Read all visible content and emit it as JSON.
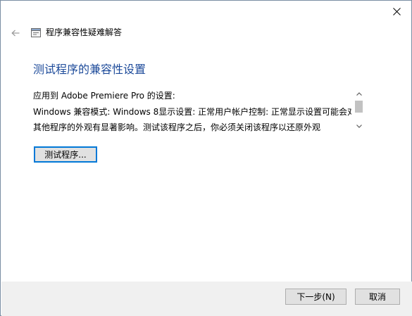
{
  "window": {
    "title": "程序兼容性疑难解答"
  },
  "page": {
    "heading": "测试程序的兼容性设置",
    "settings_lines": [
      "应用到 Adobe Premiere Pro 的设置:",
      "Windows 兼容模式: Windows 8显示设置: 正常用户帐户控制: 正常显示设置可能会对",
      "其他程序的外观有显著影响。测试该程序之后，你必须关闭该程序以还原外观"
    ],
    "test_button_label": "测试程序..."
  },
  "footer": {
    "next_label": "下一步(N)",
    "cancel_label": "取消"
  },
  "colors": {
    "heading": "#1c4a9a",
    "focus_border": "#0078d7",
    "footer_bg": "#f0f0f0",
    "button_bg": "#e1e1e1"
  }
}
